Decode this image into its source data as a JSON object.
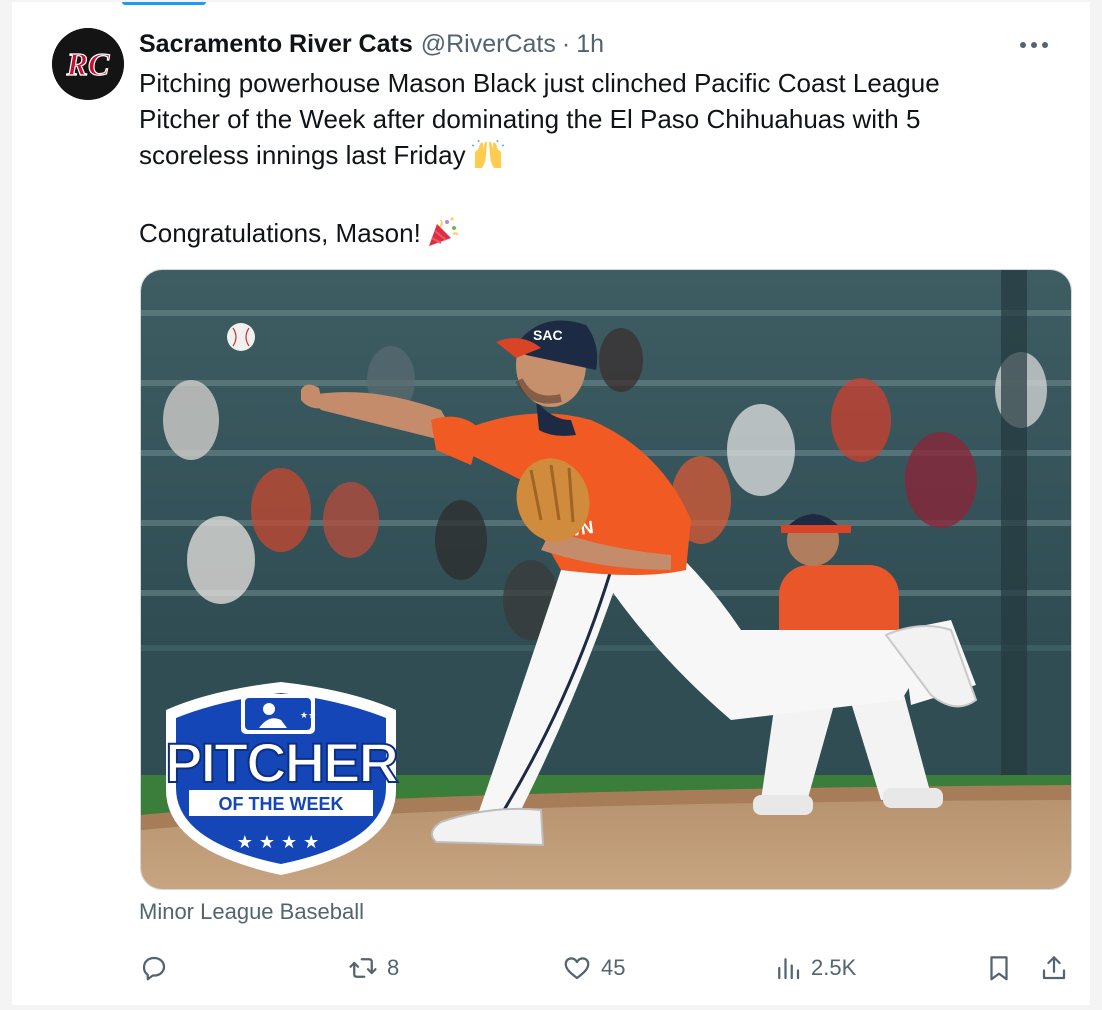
{
  "tweet": {
    "author": {
      "display_name": "Sacramento River Cats",
      "handle": "@RiverCats",
      "separator": "·",
      "time": "1h",
      "avatar_text": "RC"
    },
    "text": {
      "line1": "Pitching powerhouse Mason Black just clinched Pacific Coast League",
      "line2": "Pitcher of the Week after dominating the El Paso Chihuahuas with 5",
      "line3": "scoreless innings last Friday",
      "line4": "Congratulations, Mason!"
    },
    "emojis": [
      "raising-hands-emoji",
      "party-popper-emoji"
    ],
    "media": {
      "badge_line1": "PITCHER",
      "badge_line2": "OF THE WEEK",
      "jersey_text": "TOWN",
      "cap_text": "SAC"
    },
    "source": "Minor League Baseball",
    "actions": {
      "replies": "",
      "retweets": "8",
      "likes": "45",
      "views": "2.5K"
    }
  },
  "colors": {
    "accent": "#1d9bf0",
    "muted": "#536471",
    "text": "#0f1419",
    "jersey": "#f15a22",
    "badge_blue": "#1546b8"
  }
}
